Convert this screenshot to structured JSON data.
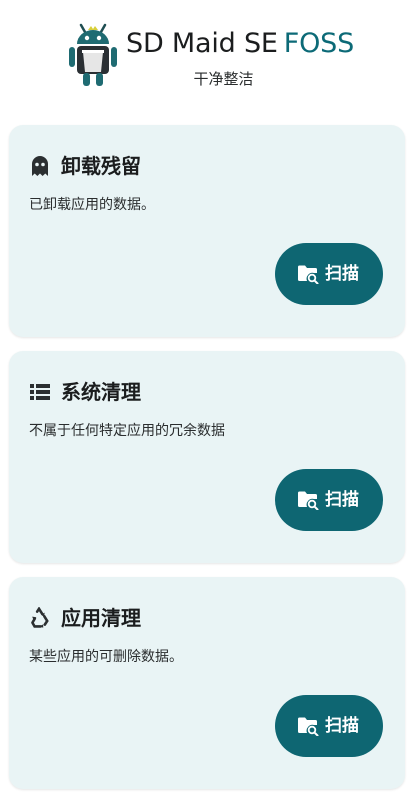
{
  "app": {
    "title_main": "SD Maid SE",
    "title_accent": "FOSS",
    "subtitle": "干净整洁",
    "logo_icon": "android-maid-robot-icon",
    "accent_color": "#0c6a77"
  },
  "cards": [
    {
      "icon": "ghost-icon",
      "title": "卸载残留",
      "description": "已卸载应用的数据。",
      "button_label": "扫描",
      "button_icon": "folder-search-icon"
    },
    {
      "icon": "list-icon",
      "title": "系统清理",
      "description": "不属于任何特定应用的冗余数据",
      "button_label": "扫描",
      "button_icon": "folder-search-icon"
    },
    {
      "icon": "recycle-icon",
      "title": "应用清理",
      "description": "某些应用的可删除数据。",
      "button_label": "扫描",
      "button_icon": "folder-search-icon"
    }
  ],
  "colors": {
    "card_background": "#e9f4f5",
    "button_background": "#0e6672",
    "text": "#1b1d1e"
  }
}
